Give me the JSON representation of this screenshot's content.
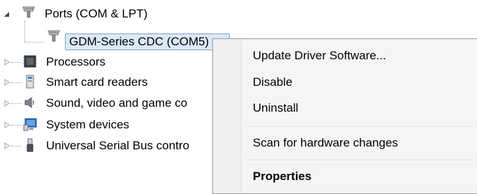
{
  "tree": {
    "items": [
      {
        "label": "Ports (COM & LPT)",
        "icon": "port-icon",
        "expanded": true
      },
      {
        "label": "GDM-Series CDC (COM5)",
        "icon": "port-icon",
        "selected": true
      },
      {
        "label": "Processors",
        "icon": "processor-icon"
      },
      {
        "label": "Smart card readers",
        "icon": "smart-card-reader-icon"
      },
      {
        "label": "Sound, video and game co",
        "icon": "speaker-icon"
      },
      {
        "label": "System devices",
        "icon": "system-devices-icon"
      },
      {
        "label": "Universal Serial Bus contro",
        "icon": "usb-icon"
      }
    ]
  },
  "context_menu": {
    "items": [
      {
        "label": "Update Driver Software..."
      },
      {
        "label": "Disable"
      },
      {
        "label": "Uninstall"
      },
      {
        "label": "Scan for hardware changes"
      },
      {
        "label": "Properties",
        "bold": true
      }
    ]
  },
  "colors": {
    "selection_fill": "#dbe9f9",
    "selection_border": "#7da2ce",
    "menu_background": "#f5f5f5"
  }
}
